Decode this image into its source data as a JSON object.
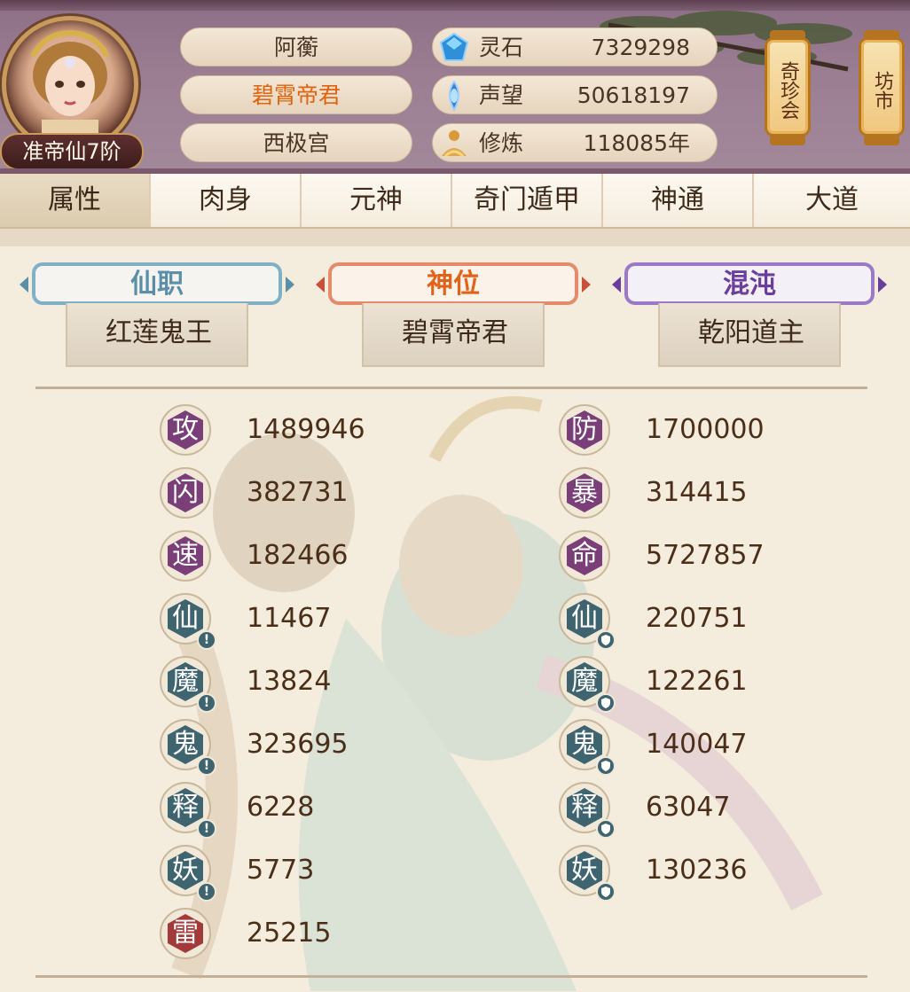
{
  "player": {
    "name": "阿蘅",
    "title": "碧霄帝君",
    "sect": "西极宫",
    "rank": "准帝仙7阶"
  },
  "resources": [
    {
      "label": "灵石",
      "value": "7329298",
      "icon": "spirit-stone-icon"
    },
    {
      "label": "声望",
      "value": "50618197",
      "icon": "prestige-icon"
    },
    {
      "label": "修炼",
      "value": "118085年",
      "icon": "cultivation-icon"
    }
  ],
  "lanterns": [
    {
      "label": "奇珍会"
    },
    {
      "label": "坊市"
    }
  ],
  "tabs": [
    {
      "label": "属性",
      "active": true
    },
    {
      "label": "肉身"
    },
    {
      "label": "元神"
    },
    {
      "label": "奇门遁甲"
    },
    {
      "label": "神通"
    },
    {
      "label": "大道"
    }
  ],
  "titles": [
    {
      "banner": "仙职",
      "value": "红莲鬼王",
      "color": "#5b8fa8"
    },
    {
      "banner": "神位",
      "value": "碧霄帝君",
      "color": "#e0631a"
    },
    {
      "banner": "混沌",
      "value": "乾阳道主",
      "color": "#6a3e9a"
    }
  ],
  "stats_left": [
    {
      "glyph": "攻",
      "value": "1489946",
      "kind": "purple"
    },
    {
      "glyph": "闪",
      "value": "382731",
      "kind": "purple"
    },
    {
      "glyph": "速",
      "value": "182466",
      "kind": "purple"
    },
    {
      "glyph": "仙",
      "value": "11467",
      "kind": "teal",
      "mark": "!"
    },
    {
      "glyph": "魔",
      "value": "13824",
      "kind": "teal",
      "mark": "!"
    },
    {
      "glyph": "鬼",
      "value": "323695",
      "kind": "teal",
      "mark": "!"
    },
    {
      "glyph": "释",
      "value": "6228",
      "kind": "teal",
      "mark": "!"
    },
    {
      "glyph": "妖",
      "value": "5773",
      "kind": "teal",
      "mark": "!"
    },
    {
      "glyph": "雷",
      "value": "25215",
      "kind": "red"
    }
  ],
  "stats_right": [
    {
      "glyph": "防",
      "value": "1700000",
      "kind": "purple"
    },
    {
      "glyph": "暴",
      "value": "314415",
      "kind": "purple"
    },
    {
      "glyph": "命",
      "value": "5727857",
      "kind": "purple"
    },
    {
      "glyph": "仙",
      "value": "220751",
      "kind": "teal",
      "mark": "shield"
    },
    {
      "glyph": "魔",
      "value": "122261",
      "kind": "teal",
      "mark": "shield"
    },
    {
      "glyph": "鬼",
      "value": "140047",
      "kind": "teal",
      "mark": "shield"
    },
    {
      "glyph": "释",
      "value": "63047",
      "kind": "teal",
      "mark": "shield"
    },
    {
      "glyph": "妖",
      "value": "130236",
      "kind": "teal",
      "mark": "shield"
    }
  ],
  "colors": {
    "purple": "#7a3e78",
    "teal": "#3e6470",
    "red": "#a23a3a"
  }
}
